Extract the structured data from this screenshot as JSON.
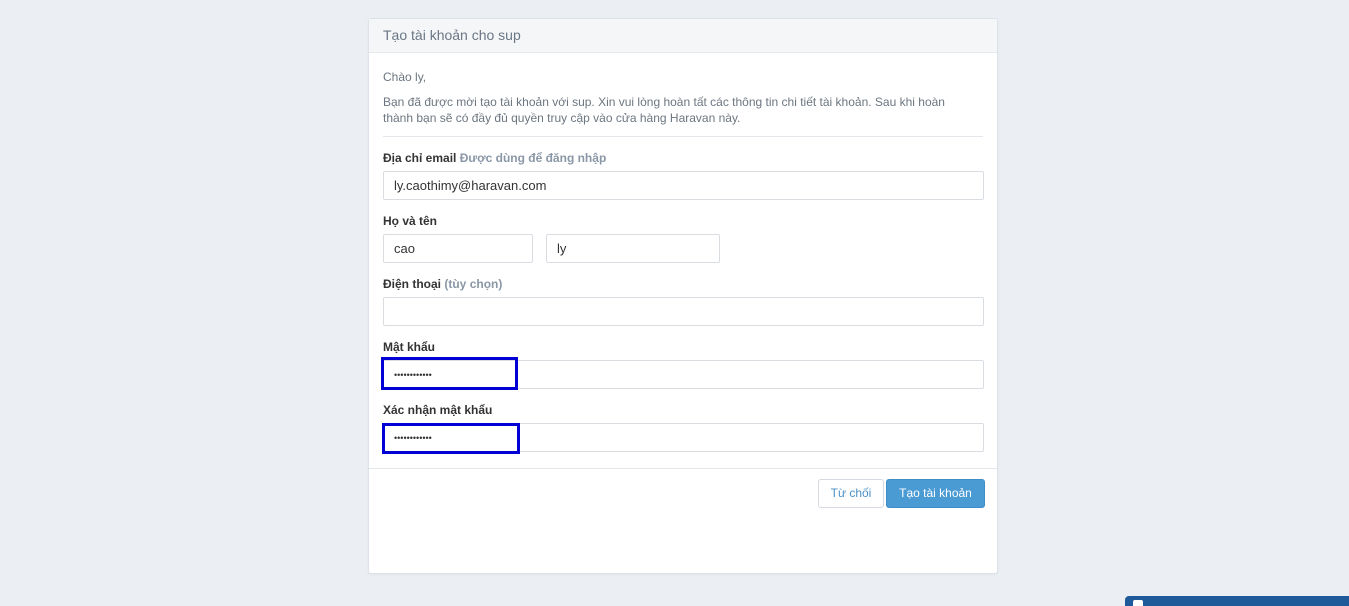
{
  "header": {
    "title": "Tạo tài khoản cho sup"
  },
  "intro": {
    "greeting": "Chào ly,",
    "message": "Bạn đã được mời tạo tài khoản với sup. Xin vui lòng hoàn tất các thông tin chi tiết tài khoản. Sau khi hoàn thành bạn sẽ có đầy đủ quyền truy cập vào cửa hàng Haravan này."
  },
  "form": {
    "email": {
      "label": "Địa chỉ email",
      "hint": "Được dùng để đăng nhập",
      "value": "ly.caothimy@haravan.com"
    },
    "name": {
      "label": "Họ và tên",
      "first": "cao",
      "last": "ly"
    },
    "phone": {
      "label": "Điện thoại",
      "hint": "(tùy chọn)",
      "value": ""
    },
    "password": {
      "label": "Mật khẩu",
      "masked": "••••••••••••"
    },
    "confirm_password": {
      "label": "Xác nhận mật khẩu",
      "masked": "••••••••••••"
    }
  },
  "actions": {
    "cancel_label": "Từ chối",
    "create_label": "Tạo tài khoản"
  },
  "colors": {
    "primary": "#4a9ad4",
    "highlight": "#0000d4",
    "background": "#ebeef2"
  }
}
